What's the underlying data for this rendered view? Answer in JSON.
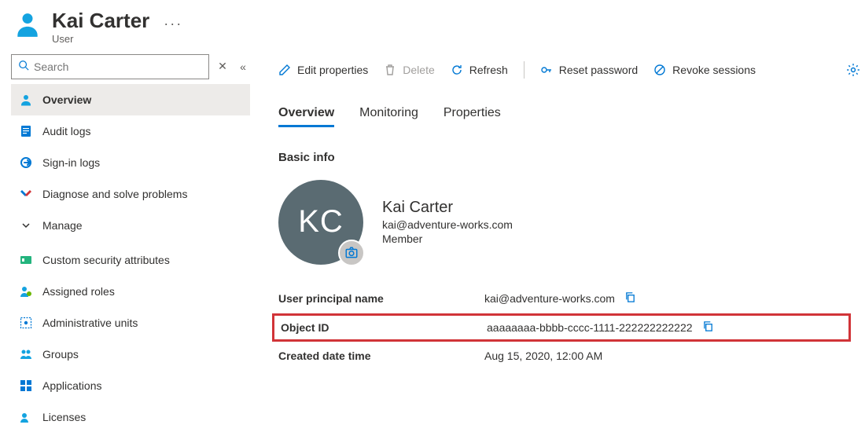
{
  "header": {
    "title": "Kai Carter",
    "subtitle": "User"
  },
  "sidebar": {
    "search_placeholder": "Search",
    "items": [
      {
        "label": "Overview",
        "selected": true
      },
      {
        "label": "Audit logs"
      },
      {
        "label": "Sign-in logs"
      },
      {
        "label": "Diagnose and solve problems"
      }
    ],
    "manage_label": "Manage",
    "manage_items": [
      {
        "label": "Custom security attributes"
      },
      {
        "label": "Assigned roles"
      },
      {
        "label": "Administrative units"
      },
      {
        "label": "Groups"
      },
      {
        "label": "Applications"
      },
      {
        "label": "Licenses"
      }
    ]
  },
  "toolbar": {
    "edit": "Edit properties",
    "delete": "Delete",
    "refresh": "Refresh",
    "reset_pw": "Reset password",
    "revoke": "Revoke sessions"
  },
  "tabs": {
    "overview": "Overview",
    "monitoring": "Monitoring",
    "properties": "Properties"
  },
  "basic_info": {
    "section_title": "Basic info",
    "initials": "KC",
    "name": "Kai Carter",
    "email": "kai@adventure-works.com",
    "member_type": "Member",
    "fields": {
      "upn_label": "User principal name",
      "upn_value": "kai@adventure-works.com",
      "oid_label": "Object ID",
      "oid_value": "aaaaaaaa-bbbb-cccc-1111-222222222222",
      "created_label": "Created date time",
      "created_value": "Aug 15, 2020, 12:00 AM"
    }
  }
}
